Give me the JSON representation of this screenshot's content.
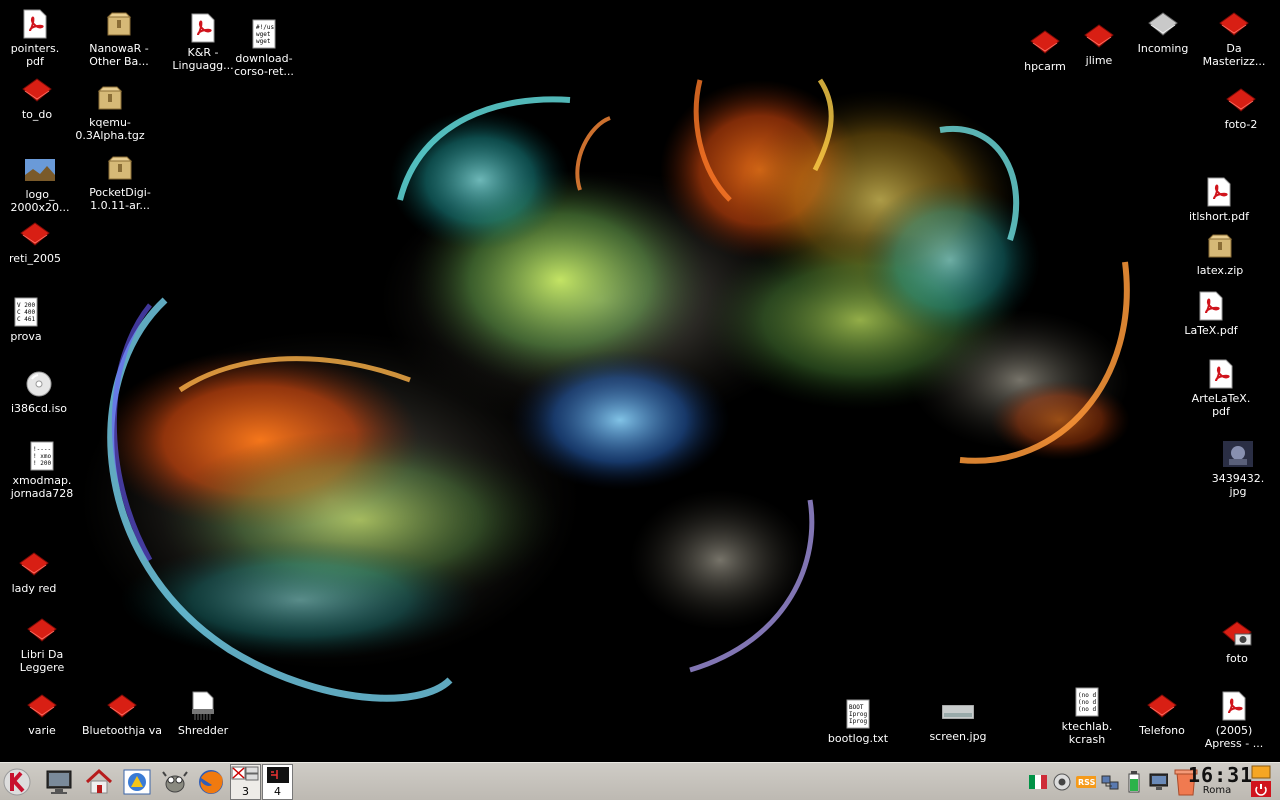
{
  "desktop": {
    "icons": [
      {
        "label": "pointers.\npdf",
        "type": "pdf"
      },
      {
        "label": "NanowaR - Other Ba...",
        "type": "archive"
      },
      {
        "label": "K&R - Linguagg...",
        "type": "pdf"
      },
      {
        "label": "download-corso-ret...",
        "type": "script"
      },
      {
        "label": "to_do",
        "type": "folder"
      },
      {
        "label": "kqemu-0.3Alpha.tgz",
        "type": "archive"
      },
      {
        "label": "logo_\n2000x20...",
        "type": "image"
      },
      {
        "label": "PocketDigi-1.0.11-ar...",
        "type": "archive"
      },
      {
        "label": "reti_2005",
        "type": "folder"
      },
      {
        "label": "prova",
        "type": "text"
      },
      {
        "label": "i386cd.iso",
        "type": "disc"
      },
      {
        "label": "xmodmap.\njornada728",
        "type": "text"
      },
      {
        "label": "lady red",
        "type": "folder"
      },
      {
        "label": "Libri Da Leggere",
        "type": "folder"
      },
      {
        "label": "varie",
        "type": "folder"
      },
      {
        "label": "Bluetoothja va",
        "type": "folder"
      },
      {
        "label": "Shredder",
        "type": "shredder"
      },
      {
        "label": "bootlog.txt",
        "type": "text"
      },
      {
        "label": "screen.jpg",
        "type": "screenshot"
      },
      {
        "label": "ktechlab.\nkcrash",
        "type": "text"
      },
      {
        "label": "Telefono",
        "type": "folder"
      },
      {
        "label": "(2005)\nApress - ...",
        "type": "pdf"
      },
      {
        "label": "hpcarm",
        "type": "folder"
      },
      {
        "label": "jlime",
        "type": "folder"
      },
      {
        "label": "Incoming",
        "type": "folder-gray"
      },
      {
        "label": "Da\nMasterizz...",
        "type": "folder"
      },
      {
        "label": "foto-2",
        "type": "folder"
      },
      {
        "label": "itlshort.pdf",
        "type": "pdf"
      },
      {
        "label": "latex.zip",
        "type": "archive"
      },
      {
        "label": "LaTeX.pdf",
        "type": "pdf"
      },
      {
        "label": "ArteLaTeX.\npdf",
        "type": "pdf"
      },
      {
        "label": "3439432.\njpg",
        "type": "photo"
      },
      {
        "label": "foto",
        "type": "folder-camera"
      }
    ]
  },
  "taskbar": {
    "launchers": [
      {
        "name": "kmenu",
        "title": "K Menu"
      },
      {
        "name": "show-desktop",
        "title": "Desktop"
      },
      {
        "name": "home",
        "title": "Home"
      },
      {
        "name": "konqueror",
        "title": "Konqueror"
      },
      {
        "name": "gimp",
        "title": "GIMP"
      },
      {
        "name": "firefox",
        "title": "Firefox"
      }
    ],
    "pager": [
      {
        "num": "3"
      },
      {
        "num": "4"
      }
    ],
    "tray": [
      {
        "name": "italian-flag-icon"
      },
      {
        "name": "speaker-icon"
      },
      {
        "name": "rss-icon"
      },
      {
        "name": "network-icon"
      },
      {
        "name": "battery-icon"
      },
      {
        "name": "monitor-icon"
      },
      {
        "name": "trash-icon"
      }
    ],
    "clock": {
      "time": "16:31",
      "city": "Roma"
    }
  },
  "colors": {
    "folder_red": "#d81f14",
    "pdf_red": "#d0141c",
    "taskbar": "#c6c3bd"
  }
}
